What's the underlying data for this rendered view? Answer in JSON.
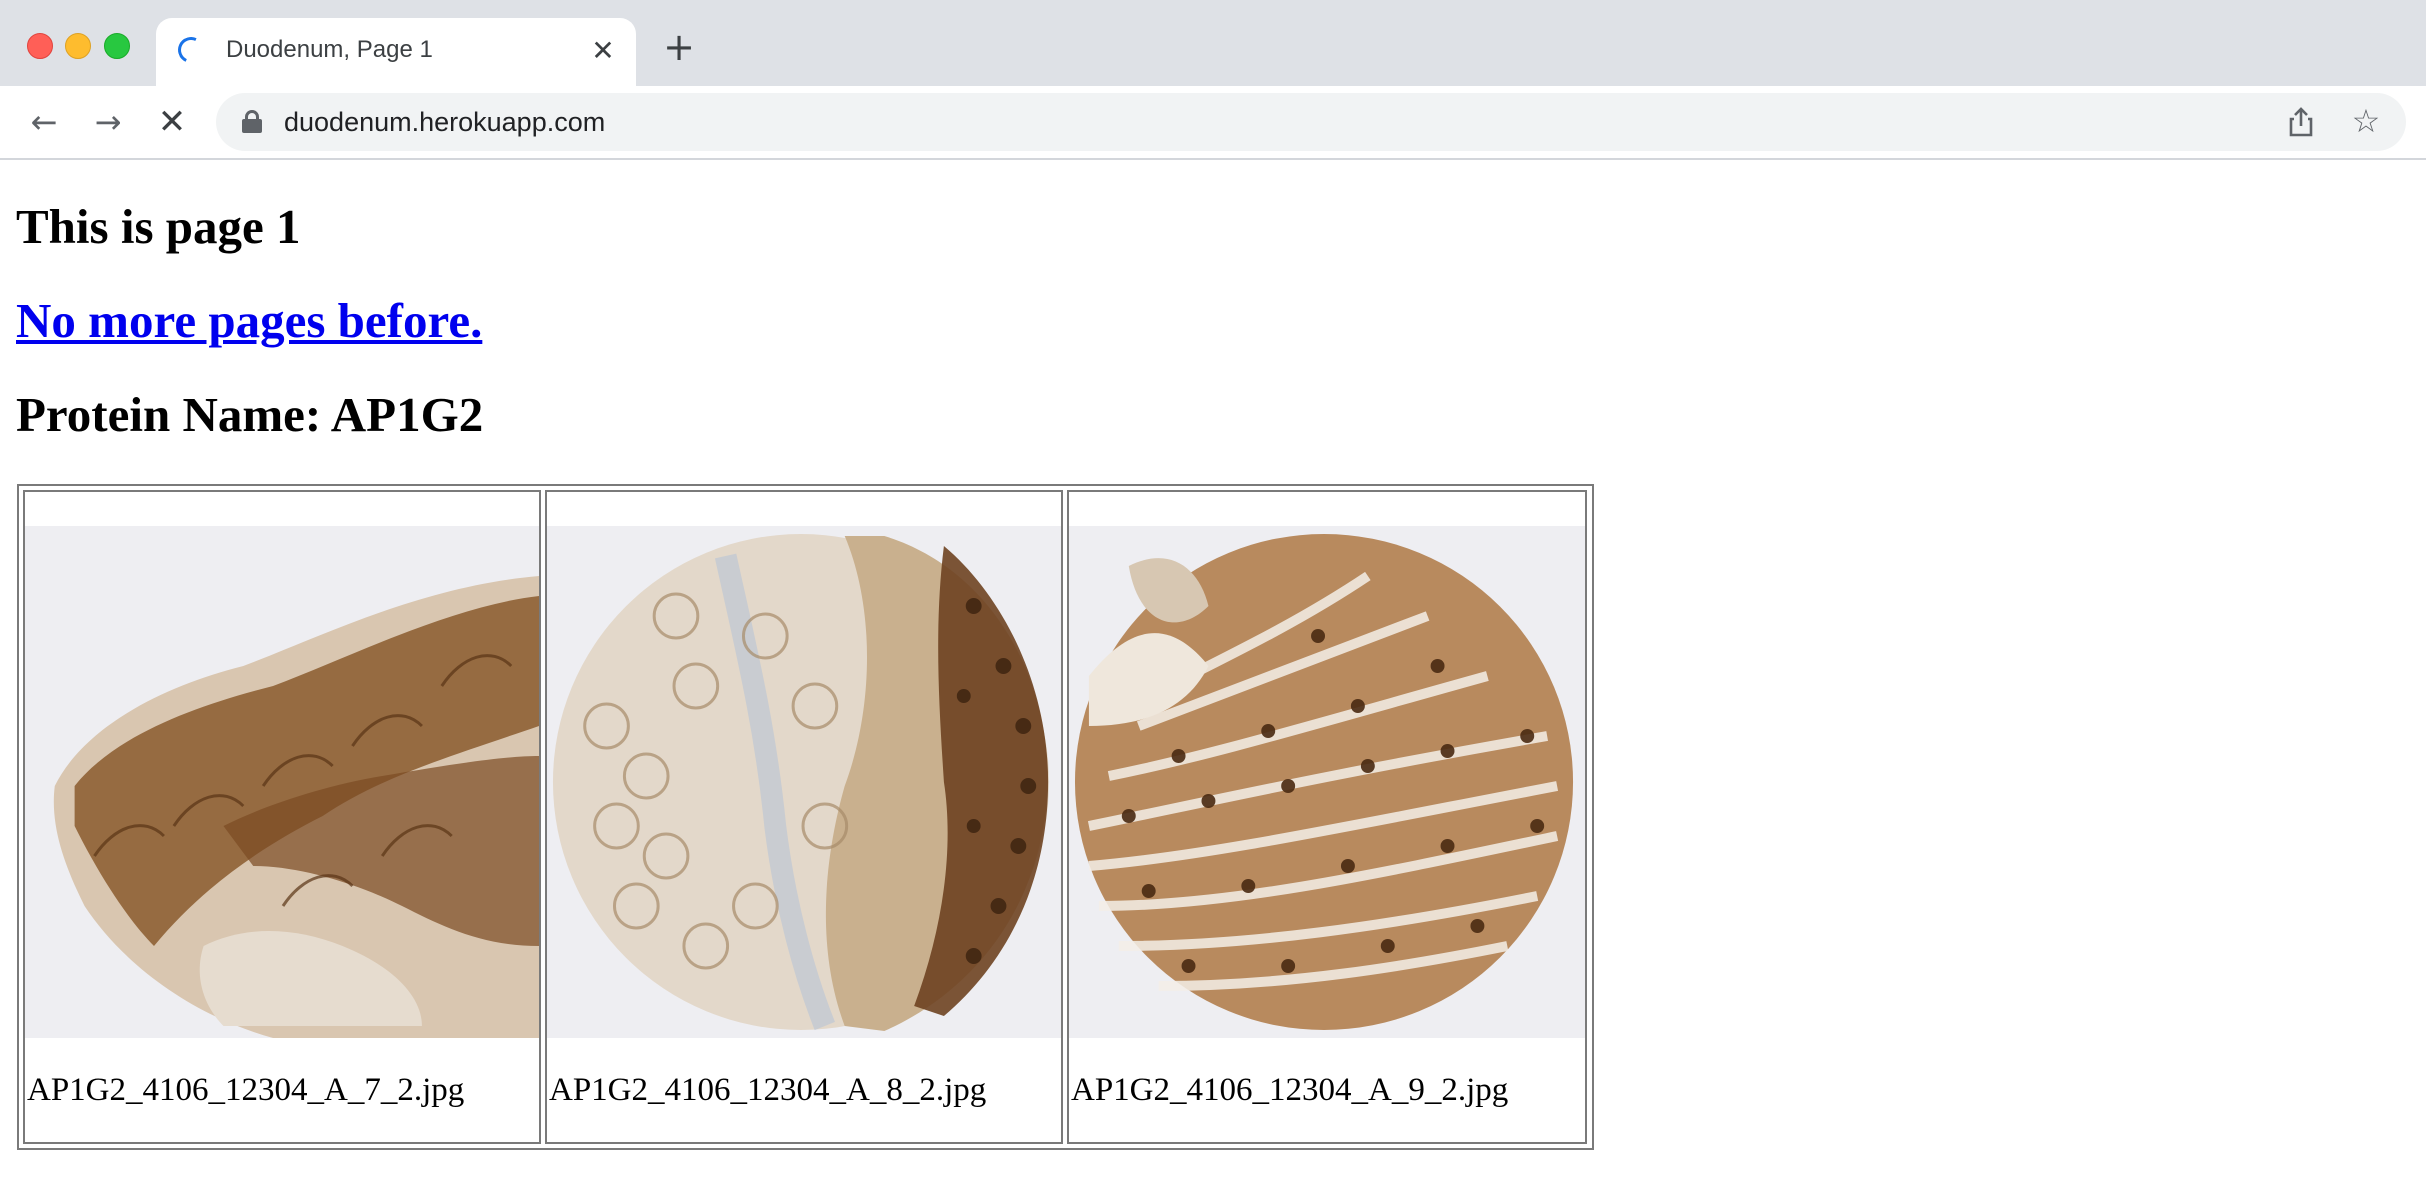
{
  "browser": {
    "tab_title": "Duodenum, Page 1",
    "url": "duodenum.herokuapp.com",
    "icons": {
      "back": "back-arrow-icon",
      "forward": "forward-arrow-icon",
      "stop": "stop-loading-icon",
      "lock": "lock-icon",
      "share": "share-icon",
      "bookmark": "star-icon",
      "close_tab": "close-icon",
      "new_tab": "plus-icon",
      "loading": "loading-spinner-icon"
    }
  },
  "page": {
    "heading": "This is page 1",
    "prev_link": "No more pages before.",
    "protein_label": "Protein Name: AP1G2"
  },
  "images": [
    {
      "caption": "AP1G2_4106_12304_A_7_2.jpg",
      "description": "duodenum tissue core, brown DAB staining"
    },
    {
      "caption": "AP1G2_4106_12304_A_8_2.jpg",
      "description": "duodenum tissue core, mostly pale with brown right edge"
    },
    {
      "caption": "AP1G2_4106_12304_A_9_2.jpg",
      "description": "duodenum tissue core, strong brown staining"
    }
  ],
  "colors": {
    "link": "#0000ee",
    "tab_bar": "#dee1e6",
    "omnibox": "#f1f3f4",
    "stain_brown": "#8a5a2e",
    "stain_light": "#d9c6b0"
  }
}
